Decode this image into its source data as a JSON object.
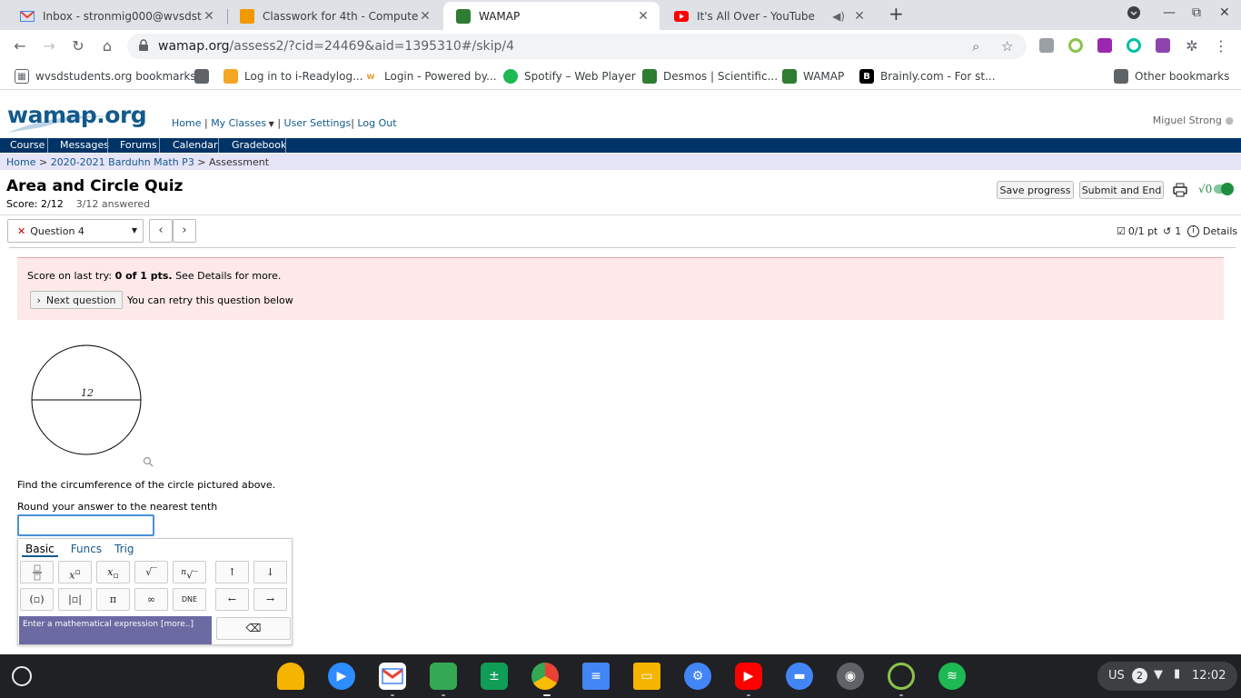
{
  "browser": {
    "tabs": [
      {
        "title": "Inbox - stronmig000@wvsdstude",
        "icon": "gmail-icon"
      },
      {
        "title": "Classwork for 4th - Computer Es",
        "icon": "classroom-icon"
      },
      {
        "title": "WAMAP",
        "icon": "wamap-icon",
        "active": true
      },
      {
        "title": "It's All Over - YouTube",
        "icon": "youtube-icon"
      }
    ],
    "url_host": "wamap.org",
    "url_path": "/assess2/?cid=24469&aid=1395310#/skip/4",
    "bookmarks": [
      "wvsdstudents.org bookmarks",
      "Log in to i-Readylog...",
      "Login - Powered by...",
      "Spotify – Web Player",
      "Desmos | Scientific...",
      "WAMAP",
      "Brainly.com - For st...",
      "Other bookmarks"
    ]
  },
  "site": {
    "logo": "wamap.org",
    "nav": {
      "home": "Home",
      "my_classes": "My Classes",
      "user_settings": "User Settings",
      "log_out": "Log Out"
    },
    "user_name": "Miguel Strong",
    "menu": [
      "Course",
      "Messages",
      "Forums",
      "Calendar",
      "Gradebook"
    ],
    "breadcrumb": {
      "home": "Home",
      "course": "2020-2021 Barduhn Math P3",
      "current": "Assessment"
    }
  },
  "assessment": {
    "title": "Area and Circle Quiz",
    "score": "Score: 2/12",
    "answered": "3/12 answered",
    "save_label": "Save progress",
    "submit_label": "Submit and End",
    "question_select": "Question 4",
    "points": "0/1 pt",
    "retries": "1",
    "details": "Details",
    "last_try_prefix": "Score on last try: ",
    "last_try_score": "0 of 1 pts.",
    "last_try_suffix": " See Details for more.",
    "next_question": "Next question",
    "retry_text": "You can retry this question below",
    "circle_label": "12",
    "question_text": "Find the circumference of the circle pictured above.",
    "round_text": "Round your answer to the nearest tenth",
    "answer_value": ""
  },
  "mathpad": {
    "tabs": [
      "Basic",
      "Funcs",
      "Trig"
    ],
    "keys_row2": [
      "π",
      "∞",
      "DNE",
      "←",
      "→"
    ],
    "arrows": [
      "↑",
      "↓"
    ],
    "help": "Enter a mathematical expression [more..]"
  },
  "shelf": {
    "lang": "US",
    "notif": "2",
    "time": "12:02"
  },
  "colors": {
    "brand_blue": "#135a8c",
    "menubar": "#003366",
    "alert_bg": "#fde9e9",
    "toggle_green": "#1e8e3e"
  }
}
